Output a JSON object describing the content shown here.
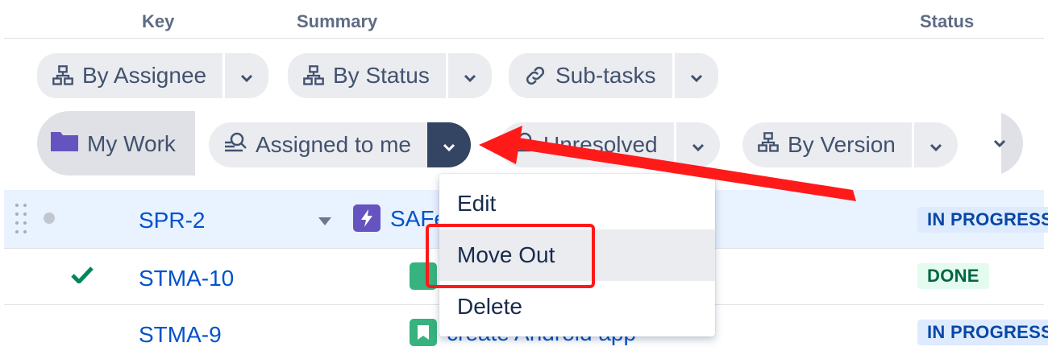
{
  "header": {
    "key_label": "Key",
    "summary_label": "Summary",
    "status_label": "Status"
  },
  "groupings": [
    {
      "label": "By Assignee",
      "icon": "hierarchy-icon"
    },
    {
      "label": "By Status",
      "icon": "hierarchy-icon"
    },
    {
      "label": "Sub-tasks",
      "icon": "link-icon"
    }
  ],
  "structure_bar": {
    "title": "My Work",
    "title_icon": "folder-icon",
    "items": [
      {
        "label": "Assigned to me",
        "icon": "filter-search-icon",
        "active": true
      },
      {
        "label": "Unresolved",
        "icon": "filter-search-icon",
        "active": false
      },
      {
        "label": "By Version",
        "icon": "hierarchy-icon",
        "active": false
      }
    ]
  },
  "rows": [
    {
      "key": "SPR-2",
      "summary": "SAFe",
      "status": "IN PROGRESS",
      "selected": true
    },
    {
      "key": "STMA-10",
      "summary": "",
      "status": "DONE",
      "done": true
    },
    {
      "key": "STMA-9",
      "summary": "create Android app",
      "status": "IN PROGRESS"
    }
  ],
  "context_menu": {
    "items": [
      "Edit",
      "Move Out",
      "Delete"
    ],
    "hovered": "Move Out"
  },
  "colors": {
    "accent_dark": "#344563",
    "link": "#0052cc",
    "annotation_red": "#ff1a1a",
    "epic_purple": "#6554c0",
    "story_green": "#36b37e"
  }
}
